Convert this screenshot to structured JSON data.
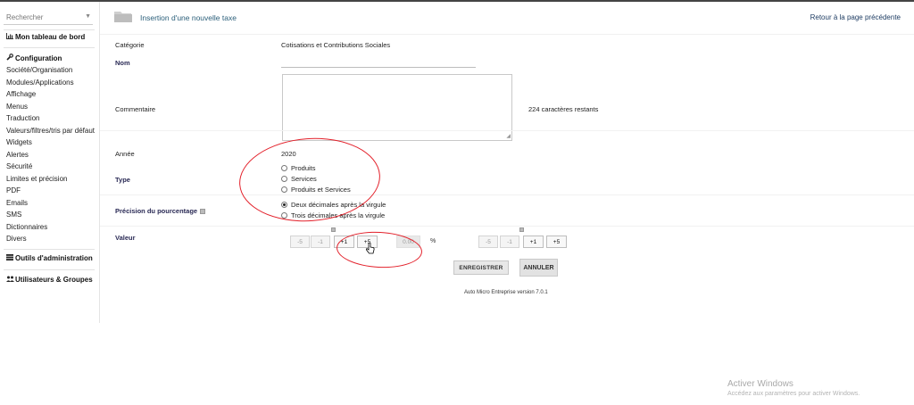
{
  "sidebar": {
    "search_placeholder": "Rechercher",
    "dashboard": "Mon tableau de bord",
    "configuration": {
      "title": "Configuration",
      "items": [
        "Société/Organisation",
        "Modules/Applications",
        "Affichage",
        "Menus",
        "Traduction",
        "Valeurs/filtres/tris par défaut",
        "Widgets",
        "Alertes",
        "Sécurité",
        "Limites et précision",
        "PDF",
        "Emails",
        "SMS",
        "Dictionnaires",
        "Divers"
      ]
    },
    "admin_tools": "Outils d'administration",
    "users_groups": "Utilisateurs & Groupes"
  },
  "header": {
    "title": "Insertion d'une nouvelle taxe",
    "back_link": "Retour à la page précédente"
  },
  "form": {
    "category_label": "Catégorie",
    "category_value": "Cotisations et Contributions Sociales",
    "name_label": "Nom",
    "name_value": "",
    "comment_label": "Commentaire",
    "comment_value": "",
    "chars_remaining": "224 caractères restants",
    "year_label": "Année",
    "year_value": "2020",
    "type_label": "Type",
    "type_options": [
      "Produits",
      "Services",
      "Produits et Services"
    ],
    "type_selected": null,
    "precision_label": "Précision du pourcentage",
    "precision_options": [
      "Deux décimales après la virgule",
      "Trois décimales après la virgule"
    ],
    "precision_selected": "Deux décimales après la virgule",
    "value_label": "Valeur",
    "steppers_left": [
      "-5",
      "-1",
      "+1",
      "+5"
    ],
    "value_field": "0.00",
    "percent_sign": "%",
    "steppers_right": [
      "-5",
      "-1",
      "+1",
      "+5"
    ],
    "save_button": "ENREGISTRER",
    "cancel_button": "ANNULER"
  },
  "footer": {
    "version": "Auto Micro Entreprise version 7.0.1"
  },
  "windows_watermark": {
    "title": "Activer Windows",
    "subtitle": "Accédez aux paramètres pour activer Windows."
  },
  "colors": {
    "title": "#2b5f7a",
    "annotation": "#e3202a"
  }
}
